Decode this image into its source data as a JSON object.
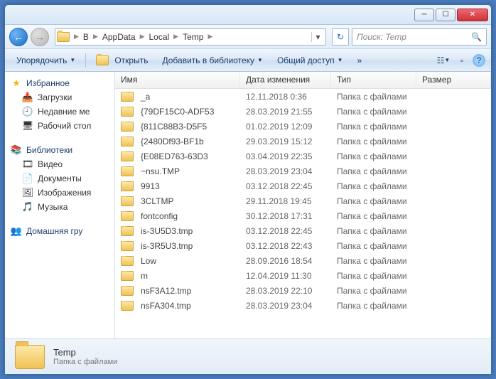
{
  "breadcrumb": [
    "B",
    "AppData",
    "Local",
    "Temp"
  ],
  "search_placeholder": "Поиск: Temp",
  "toolbar": {
    "organize": "Упорядочить",
    "open": "Открыть",
    "addlib": "Добавить в библиотеку",
    "share": "Общий доступ"
  },
  "sidebar": {
    "favorites": {
      "label": "Избранное",
      "items": [
        "Загрузки",
        "Недавние ме",
        "Рабочий стол"
      ]
    },
    "libraries": {
      "label": "Библиотеки",
      "items": [
        "Видео",
        "Документы",
        "Изображения",
        "Музыка"
      ]
    },
    "homegroup": {
      "label": "Домашняя гру"
    }
  },
  "columns": {
    "name": "Имя",
    "date": "Дата изменения",
    "type": "Тип",
    "size": "Размер"
  },
  "files": [
    {
      "name": "_a",
      "date": "12.11.2018 0:36",
      "type": "Папка с файлами"
    },
    {
      "name": "{79DF15C0-ADF53",
      "date": "28.03.2019 21:55",
      "type": "Папка с файлами"
    },
    {
      "name": "{811C88B3-D5F5",
      "date": "01.02.2019 12:09",
      "type": "Папка с файлами"
    },
    {
      "name": "{2480Df93-BF1b",
      "date": "29.03.2019 15:12",
      "type": "Папка с файлами"
    },
    {
      "name": "{E08ED763-63D3",
      "date": "03.04.2019 22:35",
      "type": "Папка с файлами"
    },
    {
      "name": "~nsu.TMP",
      "date": "28.03.2019 23:04",
      "type": "Папка с файлами"
    },
    {
      "name": "9913",
      "date": "03.12.2018 22:45",
      "type": "Папка с файлами"
    },
    {
      "name": "3CLTMP",
      "date": "29.11.2018 19:45",
      "type": "Папка с файлами"
    },
    {
      "name": "fontconfig",
      "date": "30.12.2018 17:31",
      "type": "Папка с файлами"
    },
    {
      "name": "is-3U5D3.tmp",
      "date": "03.12.2018 22:45",
      "type": "Папка с файлами"
    },
    {
      "name": "is-3R5U3.tmp",
      "date": "03.12.2018 22:43",
      "type": "Папка с файлами"
    },
    {
      "name": "Low",
      "date": "28.09.2016 18:54",
      "type": "Папка с файлами"
    },
    {
      "name": "m",
      "date": "12.04.2019 11:30",
      "type": "Папка с файлами"
    },
    {
      "name": "nsF3A12.tmp",
      "date": "28.03.2019 22:10",
      "type": "Папка с файлами"
    },
    {
      "name": "nsFA304.tmp",
      "date": "28.03.2019 23:04",
      "type": "Папка с файлами"
    }
  ],
  "status": {
    "name": "Temp",
    "type": "Папка с файлами"
  }
}
